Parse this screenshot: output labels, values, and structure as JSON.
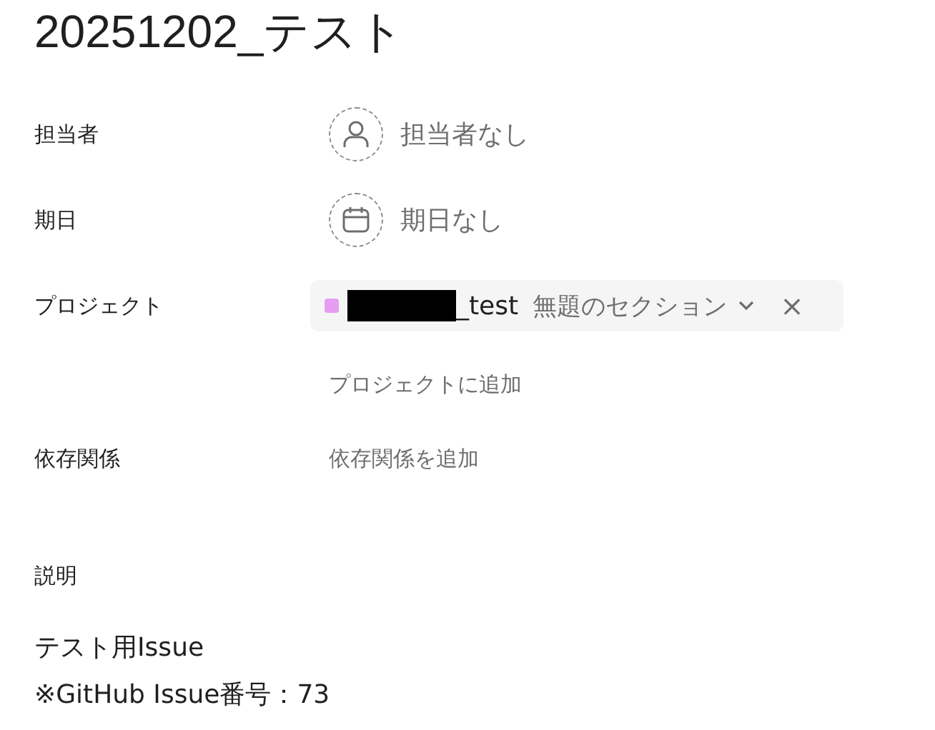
{
  "task": {
    "title": "20251202_テスト"
  },
  "fields": [
    {
      "kind": "assignee",
      "label": "担当者",
      "value": "担当者なし"
    },
    {
      "kind": "due",
      "label": "期日",
      "value": "期日なし"
    },
    {
      "kind": "project",
      "label": "プロジェクト",
      "project": {
        "color": "#e59ef0",
        "redacted": true,
        "name": "_test",
        "section": "無題のセクション",
        "remove": "×"
      },
      "add": "プロジェクトに追加"
    },
    {
      "kind": "dependency",
      "label": "依存関係",
      "value": "依存関係を追加"
    }
  ],
  "description": {
    "label": "説明",
    "lines": [
      "テスト用Issue",
      "※GitHub Issue番号：73"
    ]
  }
}
